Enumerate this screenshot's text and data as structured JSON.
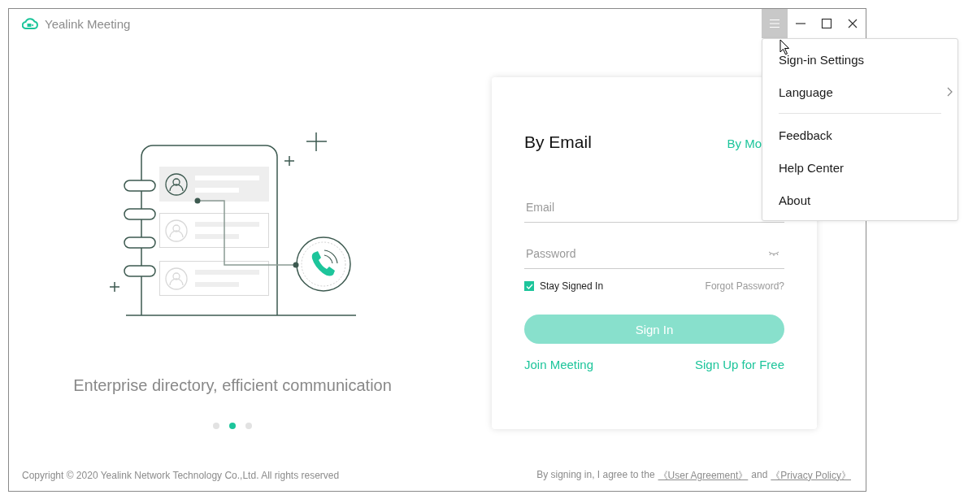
{
  "window": {
    "title": "Yealink Meeting",
    "menu_button": {
      "pressed": true
    }
  },
  "carousel": {
    "caption": "Enterprise directory, efficient communication",
    "dots": [
      {
        "selected": false
      },
      {
        "selected": true
      },
      {
        "selected": false
      }
    ]
  },
  "login": {
    "tabs": [
      {
        "label": "By Email",
        "selected": true
      },
      {
        "label": "By Mo",
        "selected": false
      }
    ],
    "fields": [
      {
        "placeholder": "Email",
        "kind": "text"
      },
      {
        "placeholder": "Password",
        "kind": "password"
      }
    ],
    "stay_signed_in": {
      "label": "Stay Signed In",
      "checked": true
    },
    "forgot_password": "Forgot Password?",
    "sign_in": {
      "label": "Sign In",
      "disabled": true
    },
    "links": [
      "Join Meeting",
      "Sign Up for Free"
    ]
  },
  "footer": {
    "copyright": "Copyright © 2020 Yealink Network Technology Co.,Ltd. All rights reserved",
    "agreement_text": "By signing in, I agree to the",
    "user_agreement": "《User Agreement》",
    "conjunction": "and",
    "privacy_policy": "《Privacy Policy》"
  },
  "menu": {
    "items": [
      {
        "kind": "item",
        "label": "Sign-in Settings",
        "submenu": false
      },
      {
        "kind": "item",
        "label": "Language",
        "submenu": true
      },
      {
        "kind": "divider"
      },
      {
        "kind": "item",
        "label": "Feedback",
        "submenu": false
      },
      {
        "kind": "item",
        "label": "Help Center",
        "submenu": false
      },
      {
        "kind": "item",
        "label": "About",
        "submenu": false
      }
    ]
  }
}
